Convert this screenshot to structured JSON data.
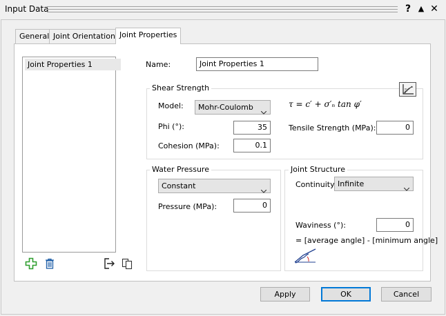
{
  "window": {
    "title": "Input Data",
    "help_glyph": "?",
    "minimize_glyph": "▲",
    "close_glyph": "✕"
  },
  "tabs": [
    {
      "label": "General",
      "active": false
    },
    {
      "label": "Joint Orientations",
      "active": false
    },
    {
      "label": "Joint Properties",
      "active": true
    }
  ],
  "list": {
    "items": [
      "Joint Properties 1"
    ],
    "icons": [
      "add-icon",
      "delete-icon",
      "import-icon",
      "copy-icon"
    ]
  },
  "form": {
    "name_label": "Name:",
    "name_value": "Joint Properties 1",
    "shear": {
      "legend": "Shear Strength",
      "model_label": "Model:",
      "model_value": "Mohr-Coulomb",
      "formula": "τ = c′ + σ′ₙ tan φ′",
      "phi_label": "Phi (°):",
      "phi_value": "35",
      "cohesion_label": "Cohesion (MPa):",
      "cohesion_value": "0.1",
      "tensile_label": "Tensile Strength (MPa):",
      "tensile_value": "0",
      "chart_icon": "strength-plot-icon"
    },
    "water": {
      "legend": "Water Pressure",
      "type_value": "Constant",
      "pressure_label": "Pressure (MPa):",
      "pressure_value": "0"
    },
    "structure": {
      "legend": "Joint Structure",
      "continuity_label": "Continuity:",
      "continuity_value": "Infinite",
      "waviness_label": "Waviness (°):",
      "waviness_value": "0",
      "waviness_note": "= [average angle] - [minimum angle]",
      "diagram_icon": "waviness-diagram-icon"
    }
  },
  "buttons": {
    "apply": "Apply",
    "ok": "OK",
    "cancel": "Cancel"
  },
  "colors": {
    "accent": "#0078d7",
    "add_icon": "#2e9e2e",
    "icon_blue": "#1f5fa8"
  }
}
